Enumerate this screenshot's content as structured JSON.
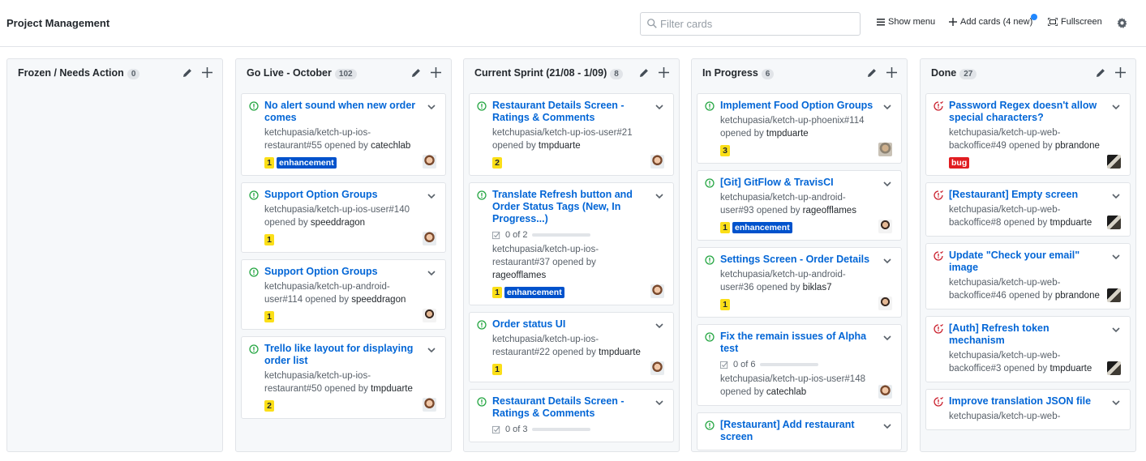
{
  "header": {
    "title": "Project Management",
    "search_placeholder": "Filter cards",
    "show_menu": "Show menu",
    "add_cards": "Add cards (4 new)",
    "fullscreen": "Fullscreen"
  },
  "colors": {
    "link": "#0366d6",
    "open_icon": "#28a745",
    "closed_icon": "#cb2431",
    "label_yellow": "#fbdf18",
    "label_enhancement": "#0052cc",
    "label_bug": "#e11d21",
    "notification_dot": "#2188ff"
  },
  "columns": [
    {
      "name": "Frozen / Needs Action",
      "count": "0",
      "cards": []
    },
    {
      "name": "Go Live - October",
      "count": "102",
      "cards": [
        {
          "title": "No alert sound when new order comes",
          "meta": "ketchupasia/ketch-up-ios-restaurant#55 opened by",
          "author": "catechlab",
          "labels": [
            "1",
            "enhancement"
          ],
          "state": "open",
          "avatar": "av-a"
        },
        {
          "title": "Support Option Groups",
          "meta": "ketchupasia/ketch-up-ios-user#140 opened by",
          "author": "speeddragon",
          "labels": [
            "1"
          ],
          "state": "open",
          "avatar": "av-a"
        },
        {
          "title": "Support Option Groups",
          "meta": "ketchupasia/ketch-up-android-user#114 opened by",
          "author": "speeddragon",
          "labels": [
            "1"
          ],
          "state": "open",
          "avatar": "av-b"
        },
        {
          "title": "Trello like layout for displaying order list",
          "meta": "ketchupasia/ketch-up-ios-restaurant#50 opened by",
          "author": "tmpduarte",
          "labels": [
            "2"
          ],
          "state": "open",
          "avatar": "av-a"
        }
      ]
    },
    {
      "name": "Current Sprint (21/08 - 1/09)",
      "count": "8",
      "cards": [
        {
          "title": "Restaurant Details Screen - Ratings & Comments",
          "meta": "ketchupasia/ketch-up-ios-user#21 opened by",
          "author": "tmpduarte",
          "labels": [
            "2"
          ],
          "state": "open",
          "avatar": "av-a"
        },
        {
          "title": "Translate Refresh button and Order Status Tags (New, In Progress...)",
          "progress": "0 of 2",
          "meta": "ketchupasia/ketch-up-ios-restaurant#37 opened by",
          "author": "rageofflames",
          "labels": [
            "1",
            "enhancement"
          ],
          "state": "open",
          "avatar": "av-a"
        },
        {
          "title": "Order status UI",
          "meta": "ketchupasia/ketch-up-ios-restaurant#22 opened by",
          "author": "tmpduarte",
          "labels": [
            "1"
          ],
          "state": "open",
          "avatar": "av-a"
        },
        {
          "title": "Restaurant Details Screen - Ratings & Comments",
          "progress": "0 of 3",
          "meta": "",
          "author": "",
          "labels": [],
          "state": "open",
          "avatar": ""
        }
      ]
    },
    {
      "name": "In Progress",
      "count": "6",
      "cards": [
        {
          "title": "Implement Food Option Groups",
          "meta": "ketchupasia/ketch-up-phoenix#114 opened by",
          "author": "tmpduarte",
          "labels": [
            "3"
          ],
          "state": "open",
          "avatar": "av-c"
        },
        {
          "title": "[Git] GitFlow & TravisCI",
          "meta": "ketchupasia/ketch-up-android-user#93 opened by",
          "author": "rageofflames",
          "labels": [
            "1",
            "enhancement"
          ],
          "state": "open",
          "avatar": "av-b"
        },
        {
          "title": "Settings Screen - Order Details",
          "meta": "ketchupasia/ketch-up-android-user#36 opened by",
          "author": "biklas7",
          "labels": [
            "1"
          ],
          "state": "open",
          "avatar": "av-b"
        },
        {
          "title": "Fix the remain issues of Alpha test",
          "progress": "0 of 6",
          "meta": "ketchupasia/ketch-up-ios-user#148 opened by",
          "author": "catechlab",
          "labels": [],
          "state": "open",
          "avatar": "av-a"
        },
        {
          "title": "[Restaurant] Add restaurant screen",
          "meta": "",
          "author": "",
          "labels": [],
          "state": "open",
          "avatar": ""
        }
      ]
    },
    {
      "name": "Done",
      "count": "27",
      "cards": [
        {
          "title": "Password Regex doesn't allow special characters?",
          "meta": "ketchupasia/ketch-up-web-backoffice#49 opened by",
          "author": "pbrandone",
          "labels": [
            "bug"
          ],
          "state": "closed",
          "avatar": "av-d"
        },
        {
          "title": "[Restaurant] Empty screen",
          "meta": "ketchupasia/ketch-up-web-backoffice#8 opened by",
          "author": "tmpduarte",
          "labels": [],
          "state": "closed",
          "avatar": "av-d"
        },
        {
          "title": "Update \"Check your email\" image",
          "meta": "ketchupasia/ketch-up-web-backoffice#46 opened by",
          "author": "pbrandone",
          "labels": [],
          "state": "closed",
          "avatar": "av-d"
        },
        {
          "title": "[Auth] Refresh token mechanism",
          "meta": "ketchupasia/ketch-up-web-backoffice#3 opened by",
          "author": "tmpduarte",
          "labels": [],
          "state": "closed",
          "avatar": "av-d"
        },
        {
          "title": "Improve translation JSON file",
          "meta": "ketchupasia/ketch-up-web-",
          "author": "",
          "labels": [],
          "state": "closed",
          "avatar": ""
        }
      ]
    }
  ]
}
